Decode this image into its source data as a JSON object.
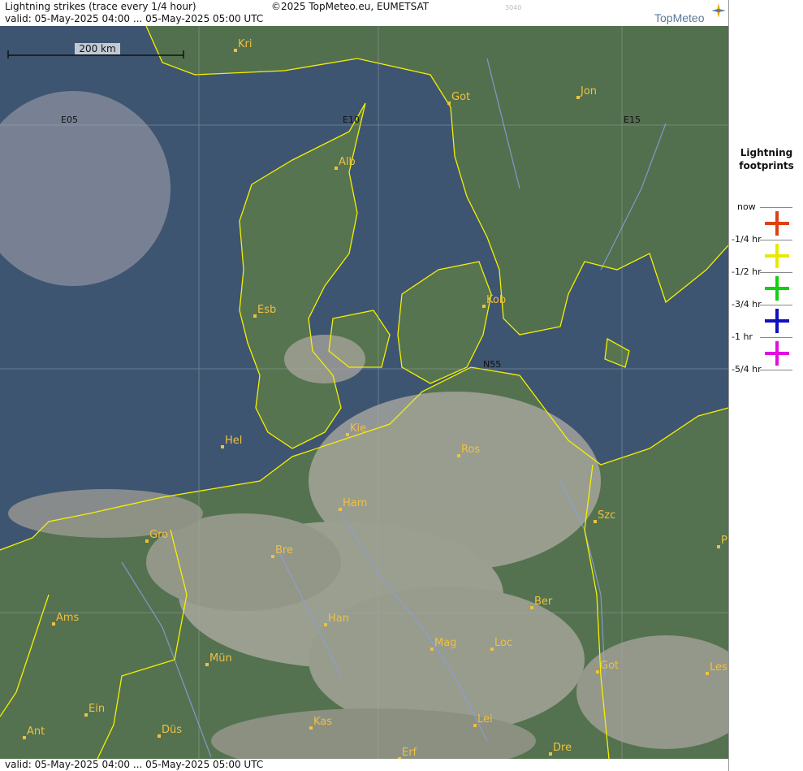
{
  "header": {
    "title": "Lightning strikes (trace every 1/4 hour)",
    "copyright": "©2025 TopMeteo.eu, EUMETSAT",
    "valid": "valid:  05-May-2025 04:00 ... 05-May-2025 05:00 UTC",
    "code": "3040",
    "logo": "TopMeteo"
  },
  "footer": {
    "valid": "valid:  05-May-2025 04:00 ... 05-May-2025 05:00 UTC"
  },
  "scale": {
    "label": "200 km"
  },
  "grid_labels": {
    "e05": "E05",
    "e10": "E10",
    "e15": "E15",
    "n55": "N55"
  },
  "cities": [
    {
      "name": "Kri"
    },
    {
      "name": "Got"
    },
    {
      "name": "Jon"
    },
    {
      "name": "Alb"
    },
    {
      "name": "Kob"
    },
    {
      "name": "Esb"
    },
    {
      "name": "Kie"
    },
    {
      "name": "Hel"
    },
    {
      "name": "Ros"
    },
    {
      "name": "Ham"
    },
    {
      "name": "Szc"
    },
    {
      "name": "Gro"
    },
    {
      "name": "Bre"
    },
    {
      "name": "P"
    },
    {
      "name": "Ber"
    },
    {
      "name": "Ams"
    },
    {
      "name": "Han"
    },
    {
      "name": "Mag"
    },
    {
      "name": "Loc"
    },
    {
      "name": "Mün"
    },
    {
      "name": "Got"
    },
    {
      "name": "Les"
    },
    {
      "name": "Ein"
    },
    {
      "name": "Kas"
    },
    {
      "name": "Lei"
    },
    {
      "name": "Ant"
    },
    {
      "name": "Düs"
    },
    {
      "name": "Dre"
    },
    {
      "name": "Erf"
    }
  ],
  "legend": {
    "title_line1": "Lightning",
    "title_line2": "footprints",
    "labels": [
      "now",
      "-1/4 hr",
      "-1/2 hr",
      "-3/4 hr",
      "-1 hr",
      "-5/4 hr"
    ],
    "colors": [
      "#e04010",
      "#e8e800",
      "#10d010",
      "#1010c0",
      "#e010e0"
    ]
  },
  "colors": {
    "sea": "#3d5571",
    "land": "#54724f",
    "coast": "#f5f000",
    "river": "#8a9fe0",
    "grid": "#a0a8b0",
    "city": "#f0c040"
  }
}
